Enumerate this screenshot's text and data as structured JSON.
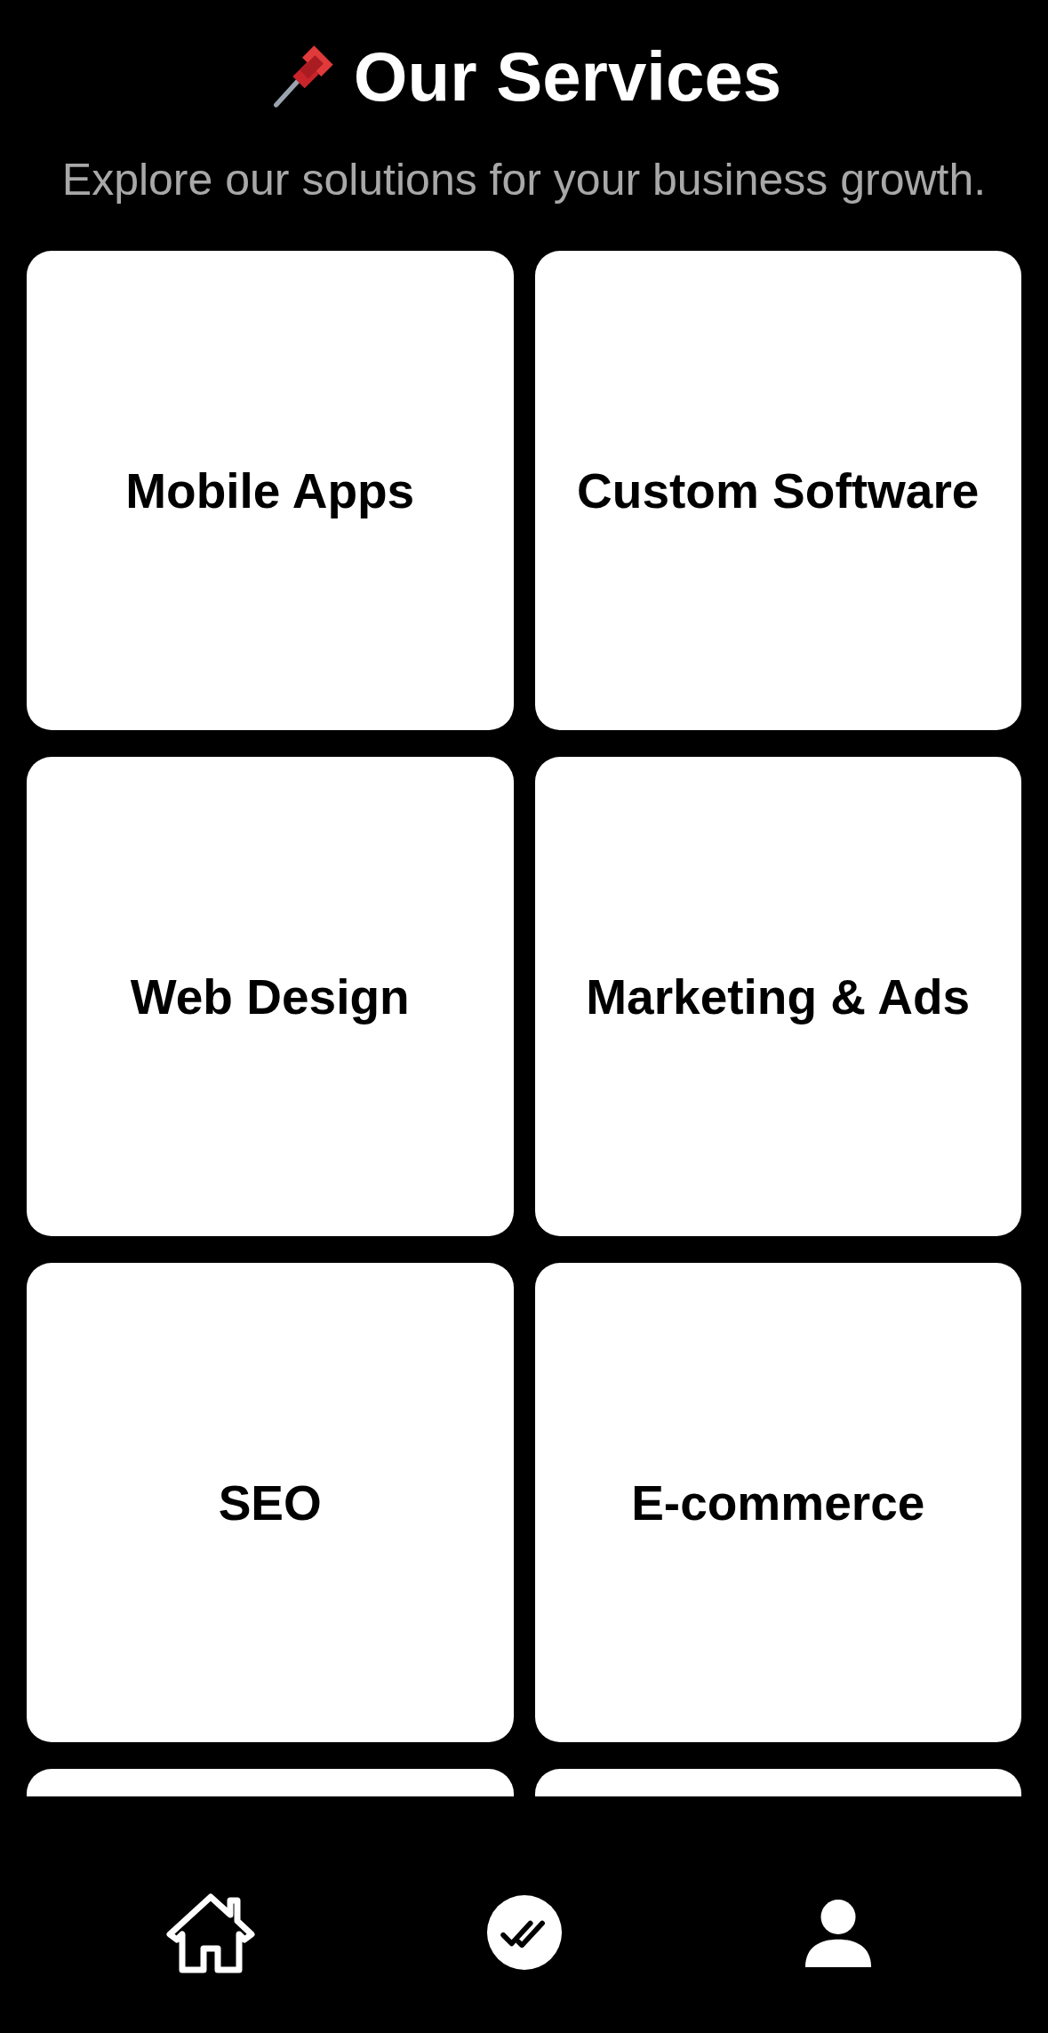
{
  "header": {
    "title": "Our Services",
    "subtitle": "Explore our solutions for your business growth."
  },
  "services": [
    {
      "label": "Mobile Apps"
    },
    {
      "label": "Custom Software"
    },
    {
      "label": "Web Design"
    },
    {
      "label": "Marketing & Ads"
    },
    {
      "label": "SEO"
    },
    {
      "label": "E-commerce"
    }
  ],
  "nav": [
    {
      "kind": "home"
    },
    {
      "kind": "check"
    },
    {
      "kind": "profile"
    }
  ]
}
